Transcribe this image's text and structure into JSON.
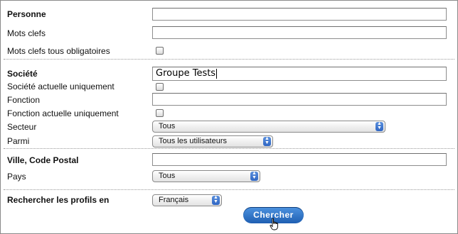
{
  "form": {
    "personne": {
      "label": "Personne",
      "value": ""
    },
    "mots_clefs": {
      "label": "Mots clefs",
      "value": ""
    },
    "mots_clefs_obligatoires": {
      "label": "Mots clefs tous obligatoires",
      "checked": false
    },
    "societe": {
      "label": "Société",
      "value": "Groupe Tests"
    },
    "societe_actuelle": {
      "label": "Société actuelle uniquement",
      "checked": false
    },
    "fonction": {
      "label": "Fonction",
      "value": ""
    },
    "fonction_actuelle": {
      "label": "Fonction actuelle uniquement",
      "checked": false
    },
    "secteur": {
      "label": "Secteur",
      "selected": "Tous"
    },
    "parmi": {
      "label": "Parmi",
      "selected": "Tous les utilisateurs"
    },
    "ville": {
      "label": "Ville, Code Postal",
      "value": ""
    },
    "pays": {
      "label": "Pays",
      "selected": "Tous"
    },
    "langue": {
      "label": "Rechercher les profils en",
      "selected": "Français"
    }
  },
  "search_button": {
    "label": "Chercher"
  },
  "colors": {
    "button_top": "#4d93e0",
    "button_bottom": "#1f5fb2",
    "select_arrow": "#2f66c4"
  },
  "icons": {
    "select_arrows": "updown-arrows-icon",
    "pointer": "hand-cursor-icon"
  }
}
